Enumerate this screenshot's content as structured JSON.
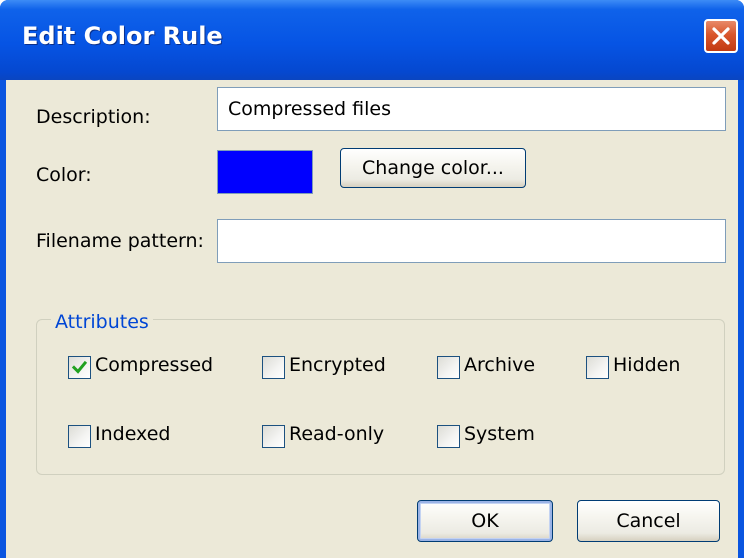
{
  "window": {
    "title": "Edit Color Rule"
  },
  "form": {
    "description_label": "Description:",
    "description_value": "Compressed files",
    "color_label": "Color:",
    "color_value": "#0000ff",
    "change_color_label": "Change color...",
    "filename_label": "Filename pattern:",
    "filename_value": ""
  },
  "attributes": {
    "legend": "Attributes",
    "items": [
      {
        "label": "Compressed",
        "checked": true
      },
      {
        "label": "Encrypted",
        "checked": false
      },
      {
        "label": "Archive",
        "checked": false
      },
      {
        "label": "Hidden",
        "checked": false
      },
      {
        "label": "Indexed",
        "checked": false
      },
      {
        "label": "Read-only",
        "checked": false
      },
      {
        "label": "System",
        "checked": false
      }
    ]
  },
  "buttons": {
    "ok": "OK",
    "cancel": "Cancel"
  },
  "colors": {
    "titlebar": "#0654e4",
    "dialog_background": "#ece9d8",
    "group_legend": "#0046d5",
    "checkmark": "#21a121"
  }
}
